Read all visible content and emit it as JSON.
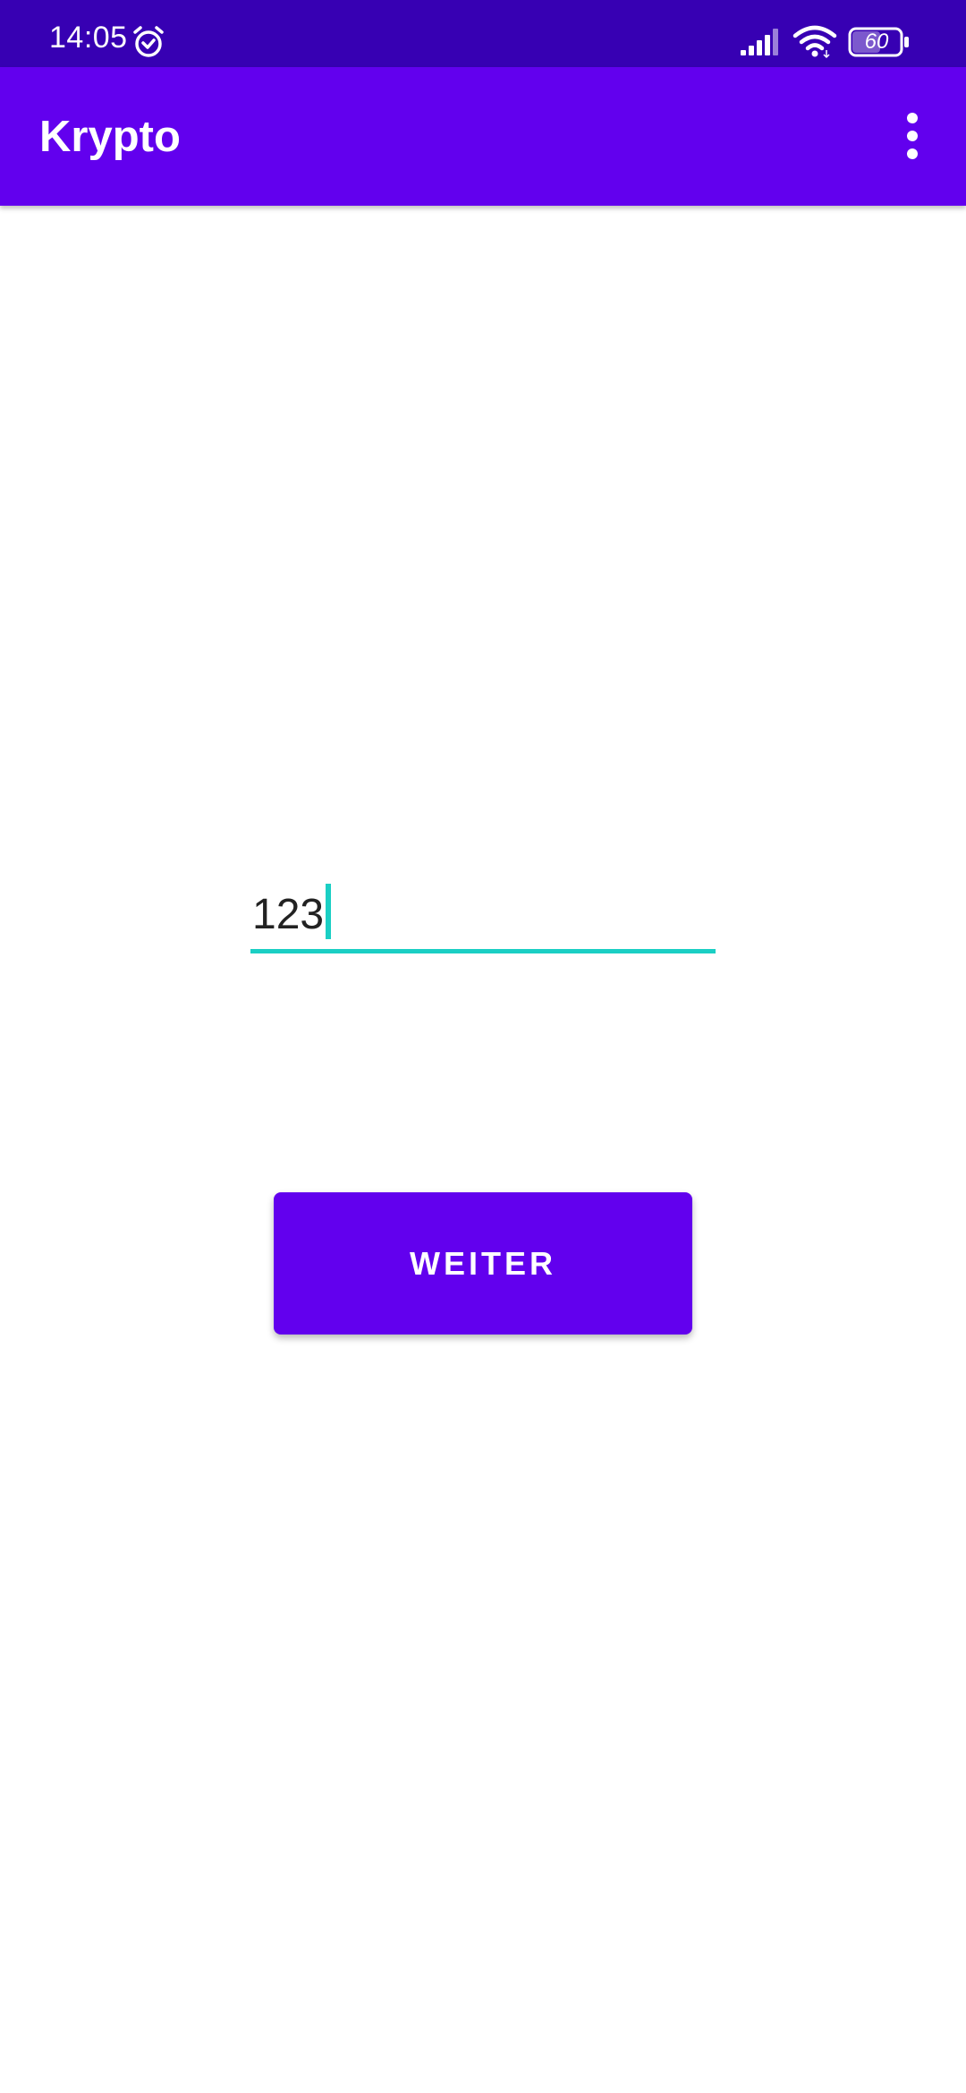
{
  "status_bar": {
    "time": "14:05",
    "battery": "60",
    "icons": [
      "alarm-icon",
      "signal-icon",
      "wifi-icon",
      "battery-icon"
    ]
  },
  "app_bar": {
    "title": "Krypto",
    "menu_icon": "overflow-menu-icon"
  },
  "form": {
    "input_value": "123",
    "button_label": "WEITER"
  },
  "colors": {
    "status_bar": "#3700B3",
    "primary": "#6200EE",
    "accent": "#1ACFC4",
    "background": "#FFFFFF"
  }
}
